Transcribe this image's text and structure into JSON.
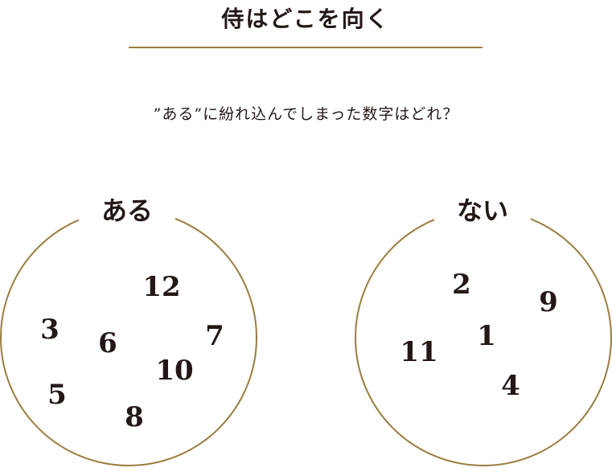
{
  "title": "侍はどこを向く",
  "question": "”ある”に紛れ込んでしまった数字はどれ？",
  "colors": {
    "accent": "#9a7d3f",
    "text": "#231815"
  },
  "groups": [
    {
      "label": "ある",
      "numbers": [
        "12",
        "3",
        "6",
        "7",
        "10",
        "5",
        "8"
      ]
    },
    {
      "label": "ない",
      "numbers": [
        "2",
        "9",
        "1",
        "11",
        "4"
      ]
    }
  ]
}
